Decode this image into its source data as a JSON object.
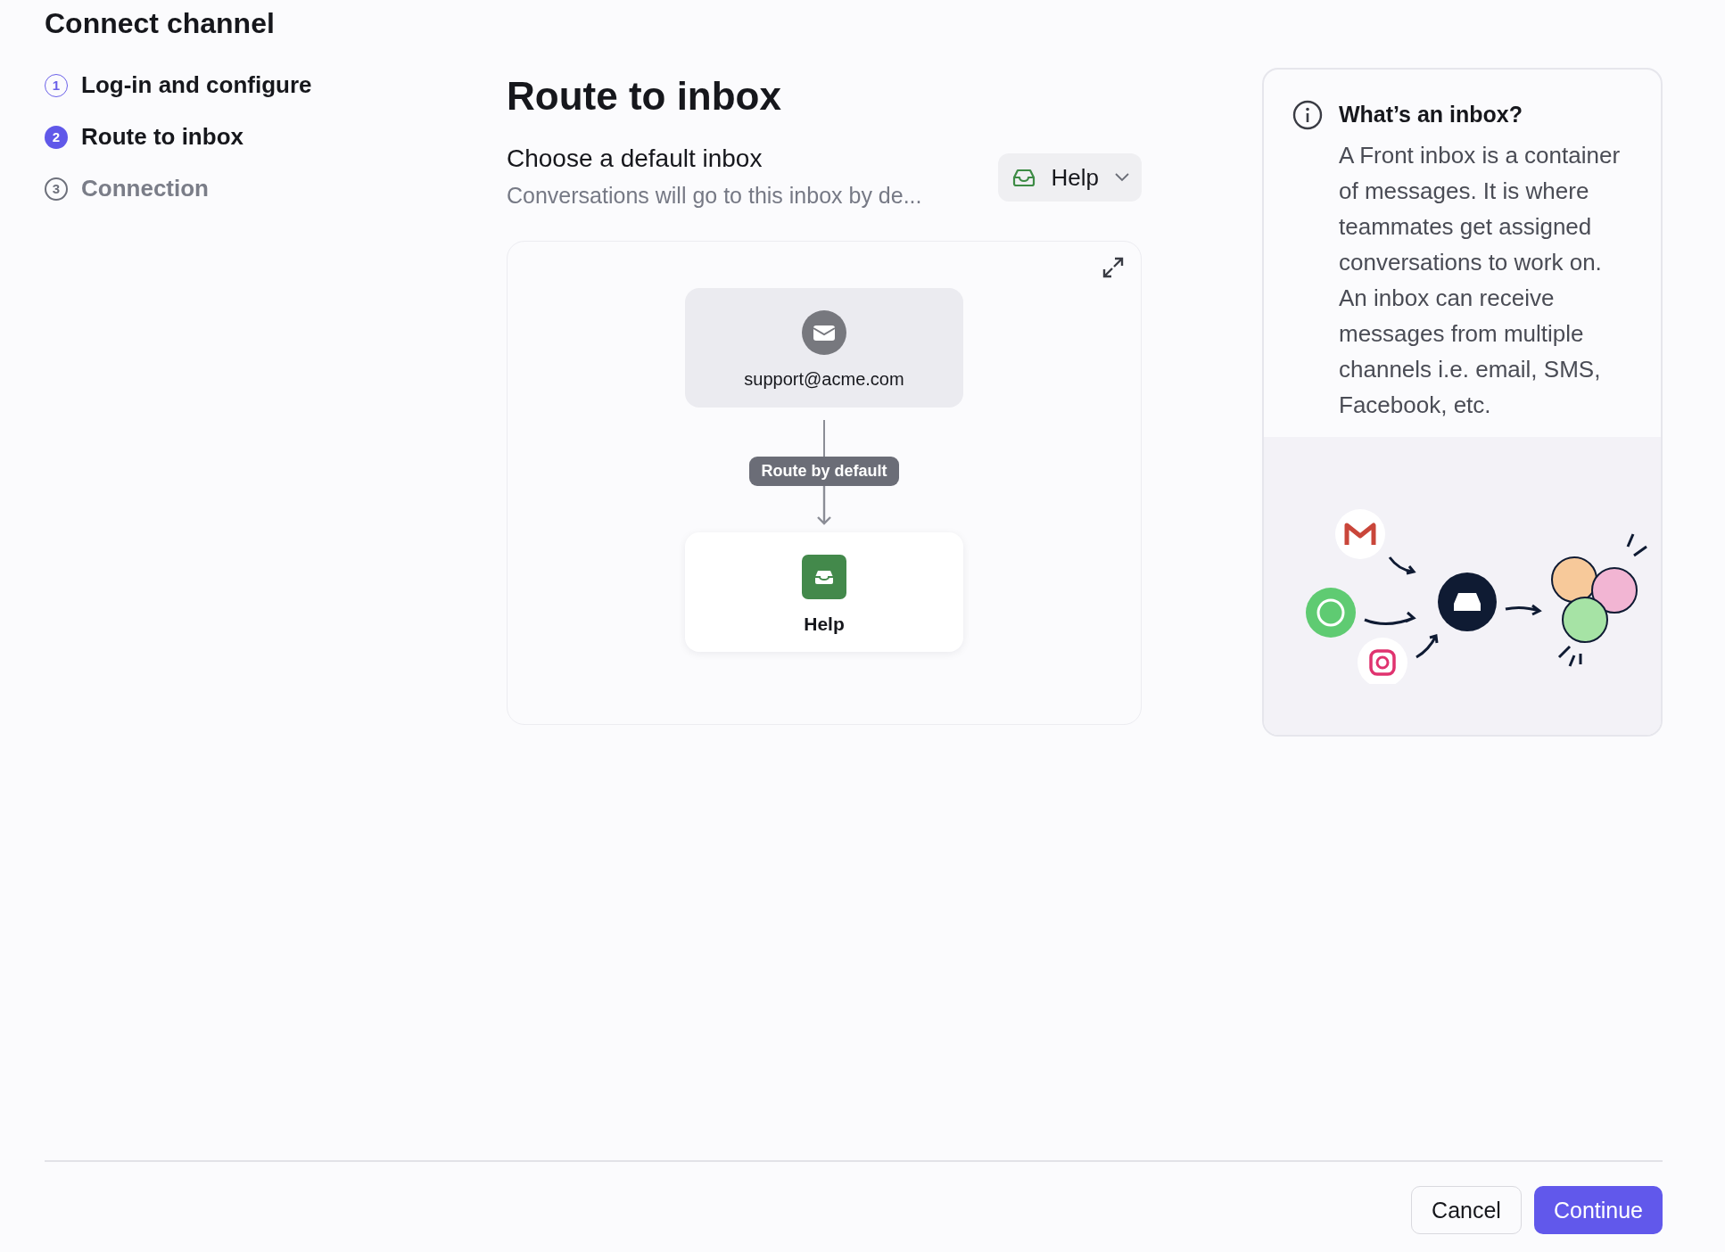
{
  "title": "Connect channel",
  "steps": [
    {
      "number": "1",
      "label": "Log-in and configure",
      "completed": true,
      "selected": false
    },
    {
      "number": "2",
      "label": "Route to inbox",
      "completed": false,
      "selected": true
    },
    {
      "number": "3",
      "label": "Connection",
      "completed": false,
      "selected": false
    }
  ],
  "main": {
    "heading": "Route to inbox",
    "field": {
      "label": "Choose a default inbox",
      "description": "Conversations will go to this inbox by de...",
      "dropdown": {
        "value": "Help"
      }
    }
  },
  "diagram": {
    "source": "support@acme.com",
    "edge_label": "Route by default",
    "target": "Help"
  },
  "info": {
    "title": "What’s an inbox?",
    "body": "A Front inbox is a container of messages. It is where teammates get assigned conversations to work on. An inbox can receive messages from multiple channels i.e. email, SMS, Facebook, etc."
  },
  "buttons": [
    {
      "label": "Cancel",
      "kind": "secondary"
    },
    {
      "label": "Continue",
      "kind": "primary"
    }
  ]
}
